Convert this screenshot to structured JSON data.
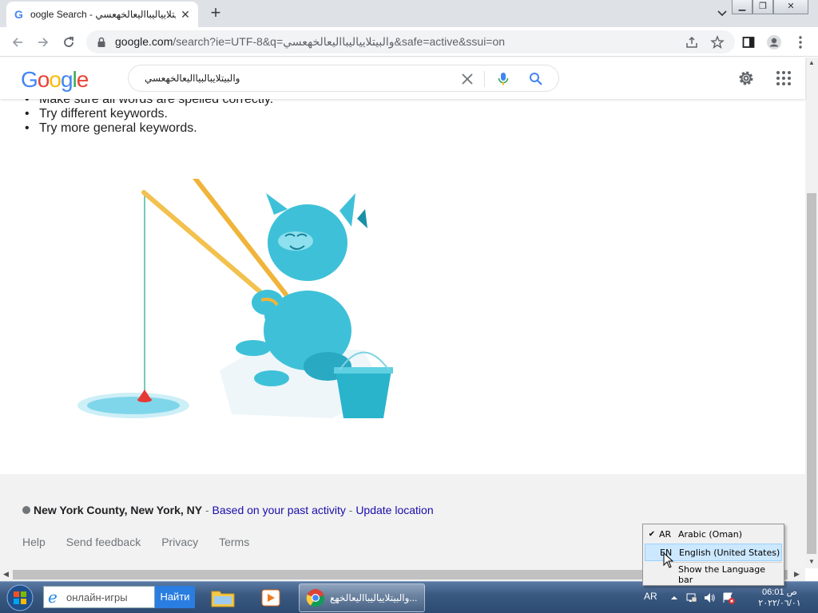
{
  "browser": {
    "tab_title": "والبيتلايياليبااليعالخهعسي - Google Search",
    "tab_title_display": "oogle Search - والبيتلايياليبااليعالخهعسي",
    "new_tab_label": "+",
    "url_host": "google.com",
    "url_path": "/search?ie=UTF-8&q=والبيتلايياليبااليعالخهعسي&safe=active&ssui=on"
  },
  "window_buttons": [
    "minimize",
    "restore",
    "close"
  ],
  "google": {
    "logo_text": [
      "G",
      "o",
      "o",
      "g",
      "l",
      "e"
    ],
    "logo_colors": [
      "#4285f4",
      "#ea4335",
      "#fbbc05",
      "#4285f4",
      "#34a853",
      "#ea4335"
    ],
    "search_query": "والبيتلايبالبيااليعالخهعسي"
  },
  "tips": [
    "Make sure all words are spelled correctly.",
    "Try different keywords.",
    "Try more general keywords."
  ],
  "footer": {
    "location_bold": "New York County, New York, NY",
    "location_sep": " - ",
    "location_link_1": "Based on your past activity",
    "location_link_2": "Update location",
    "links": [
      "Help",
      "Send feedback",
      "Privacy",
      "Terms"
    ]
  },
  "language_menu": {
    "items": [
      {
        "code": "AR",
        "label": "Arabic (Oman)",
        "checked": true
      },
      {
        "code": "EN",
        "label": "English (United States)",
        "checked": false
      }
    ],
    "show_bar_label": "Show the Language bar"
  },
  "taskbar": {
    "search_placeholder": "онлайн-игры",
    "search_button": "Найти",
    "chrome_label": "والبيتلايياليبااليعالخهع...",
    "tray_lang": "AR",
    "clock_time": "06:01 ص",
    "clock_date": "٢٠٢٢/٠٦/٠١"
  },
  "icons": {
    "back": "back-arrow-icon",
    "forward": "forward-arrow-icon",
    "reload": "reload-icon",
    "lock": "lock-icon",
    "share": "share-icon",
    "bookmark": "star-icon",
    "sidepanel": "side-panel-icon",
    "profile": "profile-icon",
    "menu": "kebab-menu-icon",
    "settings": "gear-icon",
    "apps": "apps-grid-icon"
  }
}
